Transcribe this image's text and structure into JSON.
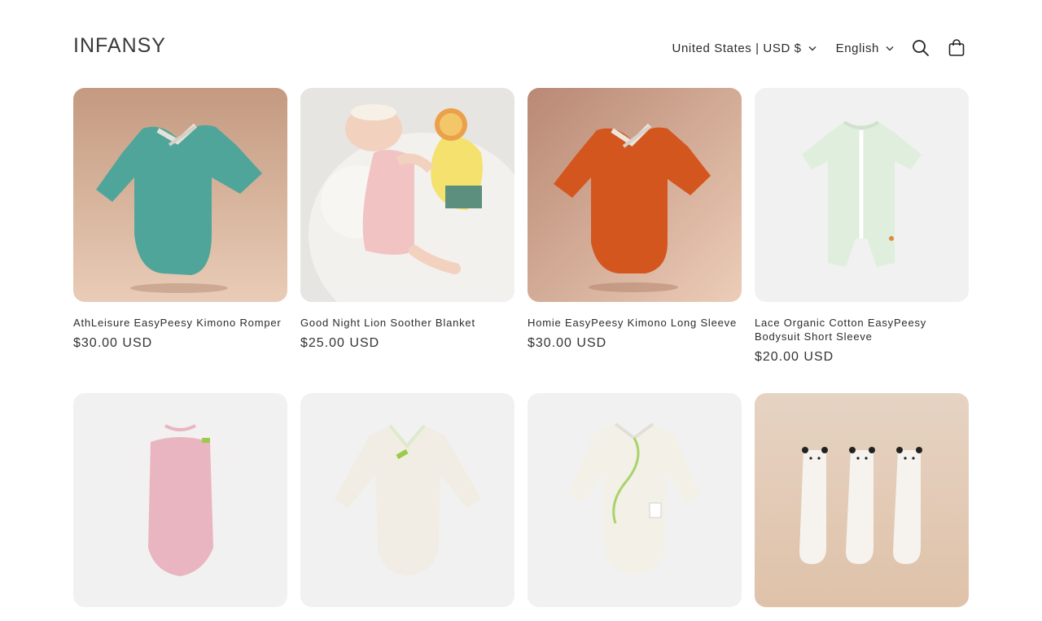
{
  "header": {
    "logo": "INFANSY",
    "country_selector": "United States | USD $",
    "language_selector": "English",
    "icons": {
      "search": "search-icon",
      "cart": "cart-icon",
      "chevron": "chevron-down-icon"
    }
  },
  "products": [
    {
      "title": "AthLeisure EasyPeesy Kimono Romper",
      "price": "$30.00 USD",
      "image": "teal-kimono-romper"
    },
    {
      "title": "Good Night Lion Soother Blanket",
      "price": "$25.00 USD",
      "image": "baby-with-lion-blanket"
    },
    {
      "title": "Homie EasyPeesy Kimono Long Sleeve",
      "price": "$30.00 USD",
      "image": "orange-kimono-long-sleeve"
    },
    {
      "title": "Lace Organic Cotton EasyPeesy Bodysuit Short Sleeve",
      "price": "$20.00 USD",
      "image": "mint-romper-short-sleeve"
    },
    {
      "title": "",
      "price": "",
      "image": "pink-bodysuit"
    },
    {
      "title": "",
      "price": "",
      "image": "cream-bodysuit-long-sleeve"
    },
    {
      "title": "",
      "price": "",
      "image": "ivory-kimono-bodysuit"
    },
    {
      "title": "",
      "price": "",
      "image": "panda-knee-socks"
    }
  ],
  "colors": {
    "bg_warm": "#c8a28a",
    "bg_light": "#f1f1f1",
    "teal": "#4fa59a",
    "orange": "#d4561f",
    "mint": "#dfeedd"
  }
}
